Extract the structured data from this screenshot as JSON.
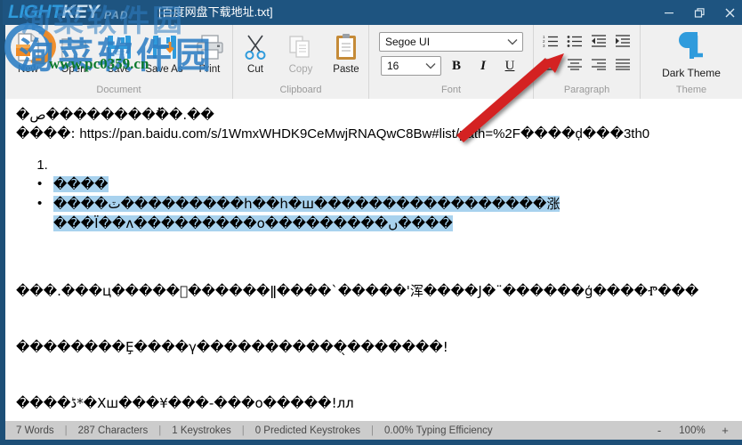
{
  "window": {
    "app_name": "LIGHTKEY",
    "app_name_part1": "LIGHT",
    "app_name_part2": "KEY",
    "app_suffix": "PAD",
    "document_title": "[百度网盘下载地址.txt]",
    "titlebar_color": "#1e5480",
    "controls": {
      "minimize": "minimize-icon",
      "restore": "restore-icon",
      "close": "close-icon"
    }
  },
  "watermark": {
    "cjk_text": "洵菜软件园",
    "top_text": "洵菜软件园",
    "url_text": "www.pc0359.cn",
    "url_color": "#0c7a2e",
    "cjk_color": "#2f7fc4"
  },
  "ribbon": {
    "groups": [
      {
        "label": "Document",
        "buttons": [
          {
            "label": "New",
            "icon": "new-document-icon"
          },
          {
            "label": "Open",
            "icon": "open-folder-icon"
          },
          {
            "label": "Save",
            "icon": "floppy-disk-icon"
          },
          {
            "label": "Save As",
            "icon": "floppy-disk-arrow-icon"
          },
          {
            "label": "Print",
            "icon": "printer-icon"
          }
        ]
      },
      {
        "label": "Clipboard",
        "buttons": [
          {
            "label": "Cut",
            "icon": "scissors-icon"
          },
          {
            "label": "Copy",
            "icon": "copy-pages-icon"
          },
          {
            "label": "Paste",
            "icon": "clipboard-icon"
          }
        ]
      },
      {
        "label": "Font",
        "font_family_value": "Segoe UI",
        "font_size_value": "16",
        "bold_label": "B",
        "italic_label": "I",
        "underline_label": "U"
      },
      {
        "label": "Paragraph",
        "buttons": [
          "numbered-list-icon",
          "bulleted-list-icon",
          "decrease-indent-icon",
          "increase-indent-icon",
          "align-left-icon",
          "align-center-icon",
          "align-right-icon",
          "align-justify-icon"
        ]
      },
      {
        "label": "Theme",
        "theme_button_label": "Dark Theme",
        "theme_button_icon": "lightkey-pilcrow-logo-icon"
      }
    ]
  },
  "document": {
    "line1": "�ص���������ُ�.��",
    "line2_prefix": "����: ",
    "line2_url": "https://pan.baidu.com/s/1WmxWHDK9CeMwjRNAQwC8Bw#list/path=%2F����ḑ���3th0",
    "ordered_item_1": "",
    "bullet_1": "����",
    "bullet_2_line1": "����ٽ���������h��h�ш�����������������涨",
    "bullet_2_line2": "���Ϊ��ʌ���������о���������ں����",
    "paragraph_line1": "���.���ц�����ͣ������ǁ����`�����'浑����Ϳ�¨������ģ����Ⱂ���",
    "paragraph_line2": "��������Ȩ����γ�����������̖�������!",
    "paragraph_line3": "����ڈ*�Xш���¥���-���о�����!лл"
  },
  "statusbar": {
    "words": "7 Words",
    "characters": "287 Characters",
    "keystrokes": "1 Keystrokes",
    "predicted_keystrokes": "0 Predicted Keystrokes",
    "typing_efficiency": "0.00% Typing Efficiency",
    "separator": "|",
    "zoom_out": "-",
    "zoom_value": "100%",
    "zoom_in": "+"
  },
  "annotation": {
    "arrow_color": "#d42222",
    "arrow_name": "red-pointer-arrow"
  }
}
